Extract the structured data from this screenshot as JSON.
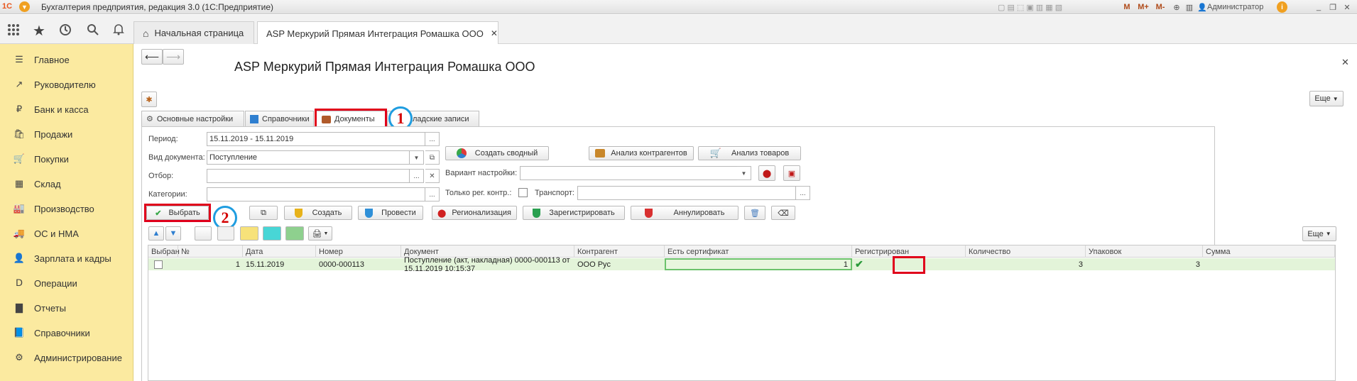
{
  "window": {
    "title": "Бухгалтерия предприятия, редакция 3.0 (1С:Предприятие)",
    "user": "Администратор",
    "m_labels": [
      "M",
      "M+",
      "M-"
    ]
  },
  "tabs": {
    "home": "Начальная страница",
    "active": "ASP Меркурий Прямая Интеграция Ромашка ООО"
  },
  "sidebar": {
    "items": [
      {
        "label": "Главное",
        "icon": "menu-icon"
      },
      {
        "label": "Руководителю",
        "icon": "trend-icon"
      },
      {
        "label": "Банк и касса",
        "icon": "ruble-icon"
      },
      {
        "label": "Продажи",
        "icon": "bag-icon"
      },
      {
        "label": "Покупки",
        "icon": "cart-icon"
      },
      {
        "label": "Склад",
        "icon": "warehouse-icon"
      },
      {
        "label": "Производство",
        "icon": "factory-icon"
      },
      {
        "label": "ОС и НМА",
        "icon": "truck-icon"
      },
      {
        "label": "Зарплата и кадры",
        "icon": "person-icon"
      },
      {
        "label": "Операции",
        "icon": "dt-kt-icon"
      },
      {
        "label": "Отчеты",
        "icon": "bar-chart-icon"
      },
      {
        "label": "Справочники",
        "icon": "book-icon"
      },
      {
        "label": "Администрирование",
        "icon": "gear-icon"
      }
    ]
  },
  "form": {
    "title": "ASP Меркурий Прямая Интеграция Ромашка ООО",
    "more": "Еще",
    "tabs": [
      "Основные настройки",
      "Справочники",
      "Документы",
      "ладские записи"
    ],
    "badge1": "1",
    "badge2": "2",
    "period_label": "Период:",
    "period_value": "15.11.2019 - 15.11.2019",
    "doc_type_label": "Вид документа:",
    "doc_type_value": "Поступление",
    "filter_label": "Отбор:",
    "categories_label": "Категории:",
    "ellipsis": "...",
    "btn_create_summary": "Создать сводный",
    "btn_analysis_counterparties": "Анализ контрагентов",
    "btn_analysis_goods": "Анализ товаров",
    "variant_label": "Вариант настройки:",
    "only_reg_label": "Только рег. контр.:",
    "transport_label": "Транспорт:",
    "actions": {
      "select": "Выбрать",
      "create": "Создать",
      "post": "Провести",
      "regionalization": "Регионализация",
      "register": "Зарегистрировать",
      "cancel": "Аннулировать"
    }
  },
  "table": {
    "columns": [
      "Выбран",
      "№",
      "Дата",
      "Номер",
      "Документ",
      "Контрагент",
      "Есть сертификат",
      "Регистрирован",
      "Количество",
      "Упаковок",
      "Сумма"
    ],
    "rows": [
      {
        "selected": "",
        "num": "1",
        "date": "15.11.2019",
        "number": "0000-000113",
        "document": "Поступление (акт, накладная) 0000-000113 от 15.11.2019 10:15:37",
        "counterparty": "ООО Рус",
        "cert": "1",
        "registered": "✔",
        "qty": "3",
        "packs": "3",
        "sum": ""
      }
    ]
  },
  "colors": {
    "sidebar": "#fbeaa0",
    "highlight_row": "#e3f4d9",
    "red_frame": "#e0001b",
    "badge_ring": "#1f9de0"
  }
}
